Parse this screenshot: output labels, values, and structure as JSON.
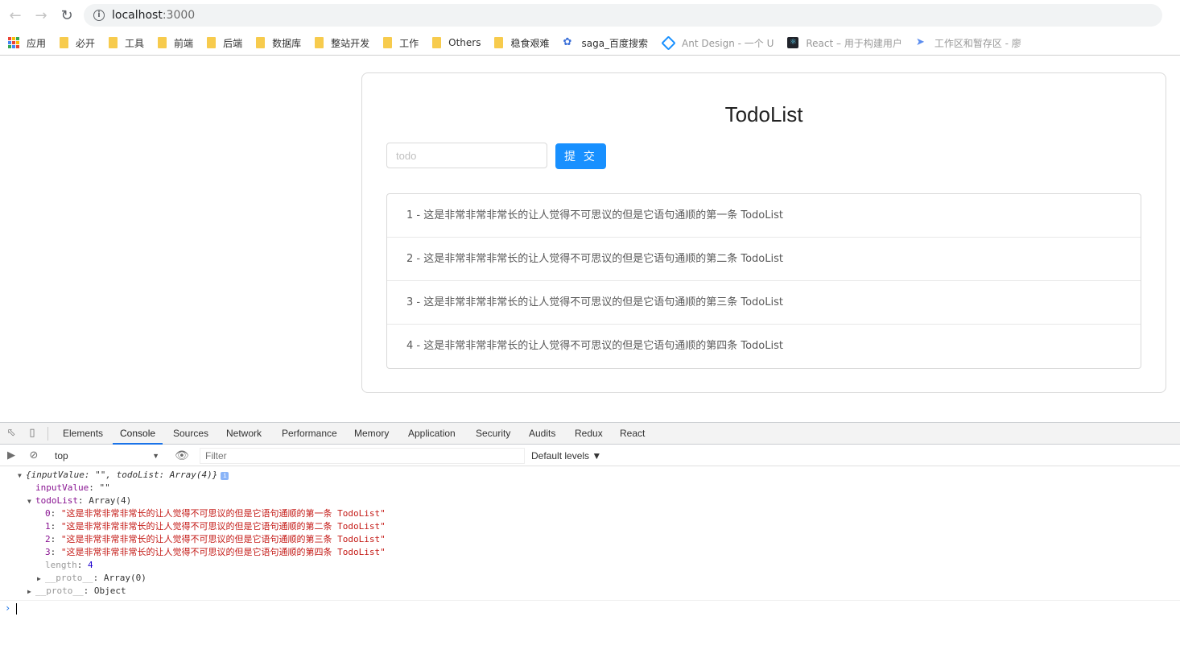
{
  "browser": {
    "url_host": "localhost",
    "url_port": ":3000"
  },
  "bookmarks": [
    {
      "label": "应用",
      "icon": "apps-icon"
    },
    {
      "label": "必开",
      "icon": "folder-icon"
    },
    {
      "label": "工具",
      "icon": "folder-icon"
    },
    {
      "label": "前端",
      "icon": "folder-icon"
    },
    {
      "label": "后端",
      "icon": "folder-icon"
    },
    {
      "label": "数据库",
      "icon": "folder-icon"
    },
    {
      "label": "整站开发",
      "icon": "folder-icon"
    },
    {
      "label": "工作",
      "icon": "folder-icon"
    },
    {
      "label": "Others",
      "icon": "folder-icon"
    },
    {
      "label": "稳食艰难",
      "icon": "folder-icon"
    },
    {
      "label": "saga_百度搜索",
      "icon": "baidu-paw-icon"
    },
    {
      "label": "Ant Design - 一个 U",
      "icon": "ant-design-icon"
    },
    {
      "label": "React – 用于构建用户",
      "icon": "react-icon"
    },
    {
      "label": "工作区和暂存区 - 廖",
      "icon": "rocket-icon"
    }
  ],
  "app": {
    "title": "TodoList",
    "input_placeholder": "todo",
    "submit_label": "提 交",
    "items": [
      "1 - 这是非常非常非常长的让人觉得不可思议的但是它语句通顺的第一条 TodoList",
      "2 - 这是非常非常非常长的让人觉得不可思议的但是它语句通顺的第二条 TodoList",
      "3 - 这是非常非常非常长的让人觉得不可思议的但是它语句通顺的第三条 TodoList",
      "4 - 这是非常非常非常长的让人觉得不可思议的但是它语句通顺的第四条 TodoList"
    ]
  },
  "devtools": {
    "tabs": [
      "Elements",
      "Console",
      "Sources",
      "Network",
      "Performance",
      "Memory",
      "Application",
      "Security",
      "Audits",
      "Redux",
      "React"
    ],
    "active_tab": "Console",
    "context": "top",
    "filter_placeholder": "Filter",
    "levels": "Default levels ▼"
  },
  "console": {
    "summary": "{inputValue: \"\", todoList: Array(4)}",
    "input_value_key": "inputValue",
    "input_value": "\"\"",
    "todolist_key": "todoList",
    "todolist_type": "Array(4)",
    "entries": [
      {
        "index": "0",
        "value": "\"这是非常非常非常长的让人觉得不可思议的但是它语句通顺的第一条 TodoList\""
      },
      {
        "index": "1",
        "value": "\"这是非常非常非常长的让人觉得不可思议的但是它语句通顺的第二条 TodoList\""
      },
      {
        "index": "2",
        "value": "\"这是非常非常非常长的让人觉得不可思议的但是它语句通顺的第三条 TodoList\""
      },
      {
        "index": "3",
        "value": "\"这是非常非常非常长的让人觉得不可思议的但是它语句通顺的第四条 TodoList\""
      }
    ],
    "length_key": "length",
    "length_value": "4",
    "proto_key": "__proto__",
    "array_proto": "Array(0)",
    "object_proto": "Object"
  },
  "colors": {
    "primary": "#1890ff",
    "folder": "#f7cb4d",
    "console_key": "#881391",
    "console_string": "#c41a16",
    "console_number": "#1c00cf"
  }
}
